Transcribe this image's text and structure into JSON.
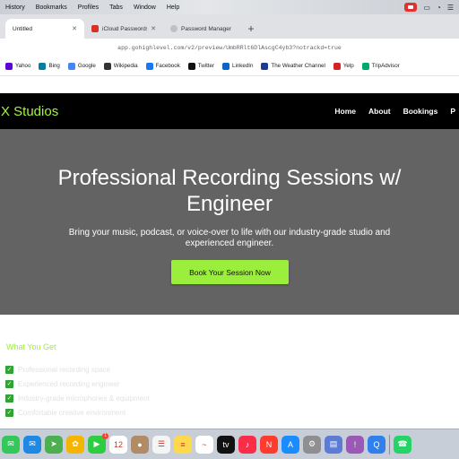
{
  "menubar": {
    "items": [
      "History",
      "Bookmarks",
      "Profiles",
      "Tabs",
      "Window",
      "Help"
    ]
  },
  "tabs": [
    {
      "label": "Untitled",
      "active": true
    },
    {
      "label": "iCloud Passwords - C",
      "active": false
    },
    {
      "label": "Password Manager",
      "active": false
    }
  ],
  "address": {
    "url": "app.gohighlevel.com/v2/preview/UmbRRlt6DlAscgC4yb3?notrackd=true"
  },
  "bookmarks": [
    {
      "label": "Yahoo",
      "icon": "yahoo-icon",
      "color": "#6001d2"
    },
    {
      "label": "Bing",
      "icon": "bing-icon",
      "color": "#00809d"
    },
    {
      "label": "Google",
      "icon": "google-icon",
      "color": "#4285f4"
    },
    {
      "label": "Wikipedia",
      "icon": "wikipedia-icon",
      "color": "#333333"
    },
    {
      "label": "Facebook",
      "icon": "facebook-icon",
      "color": "#1877f2"
    },
    {
      "label": "Twitter",
      "icon": "twitter-icon",
      "color": "#111111"
    },
    {
      "label": "LinkedIn",
      "icon": "linkedin-icon",
      "color": "#0a66c2"
    },
    {
      "label": "The Weather Channel",
      "icon": "weather-icon",
      "color": "#1b3c8c"
    },
    {
      "label": "Yelp",
      "icon": "yelp-icon",
      "color": "#d32323"
    },
    {
      "label": "TripAdvisor",
      "icon": "tripadvisor-icon",
      "color": "#00aa6c"
    }
  ],
  "site": {
    "logo": "X Studios",
    "nav": [
      "Home",
      "About",
      "Bookings",
      "P"
    ],
    "hero": {
      "title": "Professional Recording Sessions w/ Engineer",
      "subtitle": "Bring your music, podcast, or voice-over to life with our industry-grade studio and experienced engineer.",
      "cta": "Book Your Session Now"
    },
    "section_title": "What You Get",
    "features": [
      "Professional recording space",
      "Experienced recording engineer",
      "Industry-grade microphones & equipment",
      "Comfortable creative environment"
    ]
  },
  "colors": {
    "accent": "#9bef3c",
    "hero_bg": "#636363",
    "nav_bg": "#000000"
  },
  "dock": {
    "apps": [
      {
        "name": "messages-icon",
        "color": "#34c759",
        "glyph": "✉"
      },
      {
        "name": "mail-icon",
        "color": "#1e88e5",
        "glyph": "✉"
      },
      {
        "name": "maps-icon",
        "color": "#4caf50",
        "glyph": "➤"
      },
      {
        "name": "photos-icon",
        "color": "#f4b400",
        "glyph": "✿"
      },
      {
        "name": "facetime-icon",
        "color": "#2ecc40",
        "glyph": "▶",
        "badge": "1"
      },
      {
        "name": "calendar-icon",
        "color": "#ffffff",
        "glyph": "12"
      },
      {
        "name": "contacts-icon",
        "color": "#b08b66",
        "glyph": "●"
      },
      {
        "name": "reminders-icon",
        "color": "#f5f5f5",
        "glyph": "☰"
      },
      {
        "name": "notes-icon",
        "color": "#ffd84d",
        "glyph": "≡"
      },
      {
        "name": "freeform-icon",
        "color": "#ffffff",
        "glyph": "~"
      },
      {
        "name": "appletv-icon",
        "color": "#111111",
        "glyph": "tv"
      },
      {
        "name": "music-icon",
        "color": "#fa2d48",
        "glyph": "♪"
      },
      {
        "name": "news-icon",
        "color": "#ff3b30",
        "glyph": "N"
      },
      {
        "name": "appstore-icon",
        "color": "#1a8cff",
        "glyph": "A"
      },
      {
        "name": "settings-icon",
        "color": "#8e8e93",
        "glyph": "⚙"
      },
      {
        "name": "preview-icon",
        "color": "#5b7bd5",
        "glyph": "▤"
      },
      {
        "name": "podcasts-icon",
        "color": "#9b59b6",
        "glyph": "!"
      },
      {
        "name": "quicktime-icon",
        "color": "#2f80ed",
        "glyph": "Q"
      },
      {
        "name": "whatsapp-icon",
        "color": "#25d366",
        "glyph": "☎"
      }
    ]
  }
}
